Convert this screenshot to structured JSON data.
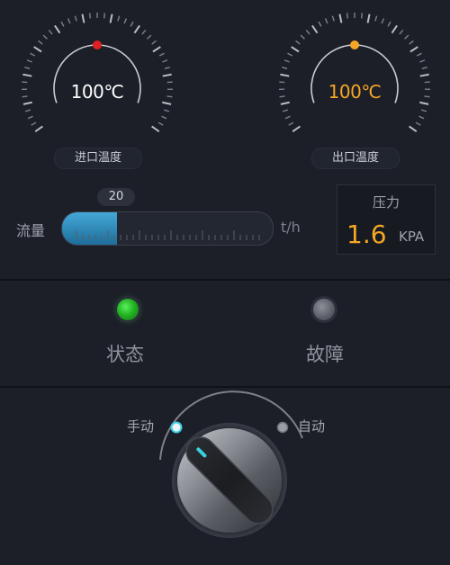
{
  "gauges": {
    "inlet": {
      "value": "100℃",
      "label": "进口温度",
      "indicator_color": "#e02020",
      "value_color": "#ffffff"
    },
    "outlet": {
      "value": "100℃",
      "label": "出口温度",
      "indicator_color": "#f5a623",
      "value_color": "#f5a623"
    }
  },
  "flow": {
    "label": "流量",
    "value": "20",
    "unit": "t/h",
    "level": 0.26,
    "fill_color": "#3a9bd0"
  },
  "pressure": {
    "title": "压力",
    "value": "1.6",
    "unit": "KPA",
    "value_color": "#f5a623"
  },
  "indicators": {
    "status": {
      "label": "状态",
      "state": "on",
      "color": "#27b827"
    },
    "fault": {
      "label": "故障",
      "state": "off",
      "color": "#6e717a"
    }
  },
  "mode_switch": {
    "manual_label": "手动",
    "auto_label": "自动",
    "selected": "manual",
    "active_color": "#3ad0e0"
  }
}
